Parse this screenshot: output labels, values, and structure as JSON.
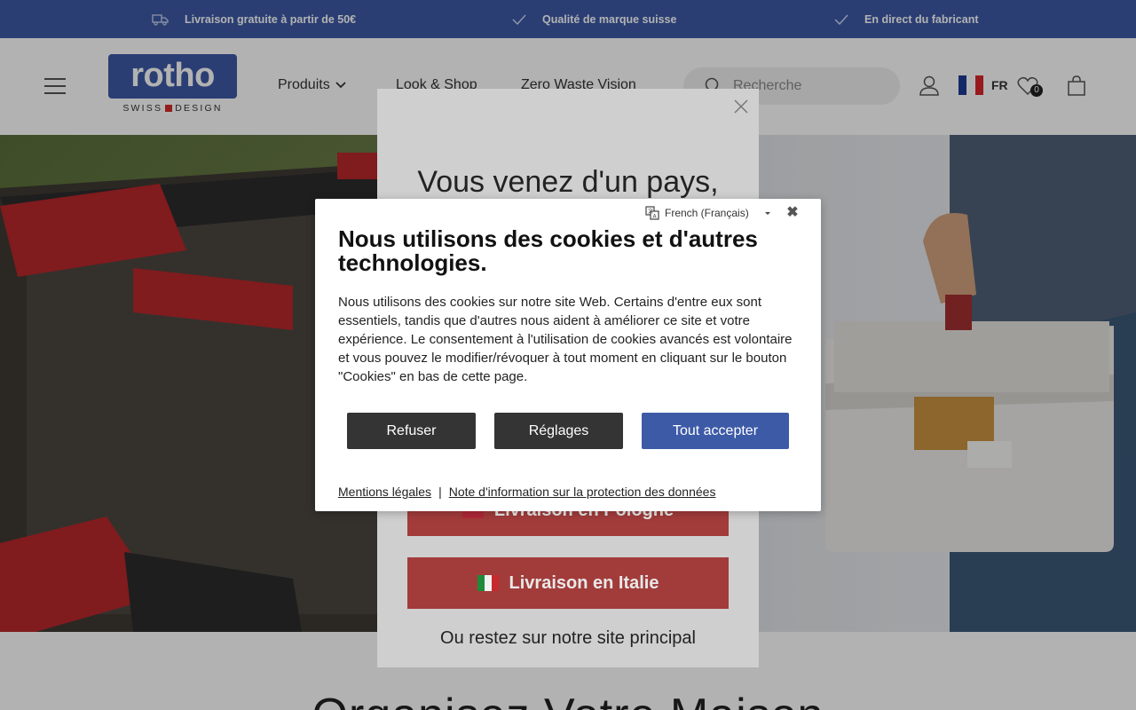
{
  "promo": {
    "items": [
      {
        "icon": "truck-icon",
        "text": "Livraison gratuite à partir de 50€"
      },
      {
        "icon": "checkmark-icon",
        "text": "Qualité de marque suisse"
      },
      {
        "icon": "checkmark-icon",
        "text": "En direct du fabricant"
      }
    ],
    "bg_color": "#3d5aa7"
  },
  "header": {
    "logo_text": "rotho",
    "logo_sub_left": "SWISS",
    "logo_sub_right": "DESIGN",
    "nav": [
      "Produits",
      "Look & Shop",
      "Zero Waste Vision"
    ],
    "search_placeholder": "Recherche",
    "lang_code": "FR",
    "wishlist_count": "0"
  },
  "country_modal": {
    "title": "Vous venez d'un pays,",
    "buttons": [
      {
        "label": "Livraison en Pologne",
        "flag": "pl-flag-icon"
      },
      {
        "label": "Livraison en Italie",
        "flag": "it-flag-icon"
      }
    ],
    "stay_label": "Ou restez sur notre site principal"
  },
  "cookie_dialog": {
    "language_option": "French (Français)",
    "title": "Nous utilisons des cookies et d'autres technologies.",
    "body": "Nous utilisons des cookies sur notre site Web. Certains d'entre eux sont essentiels, tandis que d'autres nous aident à améliorer ce site et votre expérience. Le consentement à l'utilisation de cookies avancés est volontaire et vous pouvez le modifier/révoquer à tout moment en cliquant sur le bouton \"Cookies\" en bas de cette page.",
    "btn_refuse": "Refuser",
    "btn_settings": "Réglages",
    "btn_accept": "Tout accepter",
    "link_legal": "Mentions légales",
    "link_separator": "|",
    "link_privacy": "Note d'information sur la protection des données",
    "accent_color": "#3d5aa7"
  },
  "below_hero": {
    "title": "Organisez Votre Maison"
  }
}
